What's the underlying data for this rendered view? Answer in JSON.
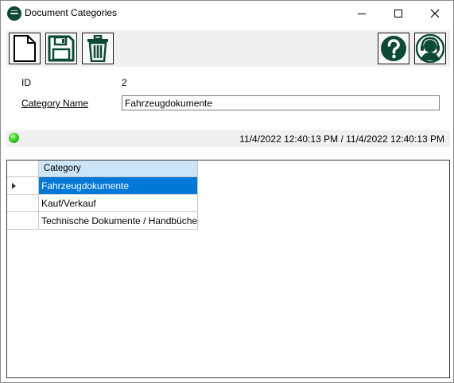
{
  "window": {
    "title": "Document Categories"
  },
  "toolbar": {
    "buttons": [
      {
        "name": "new",
        "icon": "new-document-icon"
      },
      {
        "name": "save",
        "icon": "save-icon"
      },
      {
        "name": "delete",
        "icon": "trash-icon"
      },
      {
        "name": "help",
        "icon": "help-icon"
      },
      {
        "name": "support",
        "icon": "support-headset-icon"
      }
    ],
    "icon_color": "#0d4a33"
  },
  "form": {
    "id_label": "ID",
    "id_value": "2",
    "category_label": "Category Name",
    "category_value": "Fahrzeugdokumente"
  },
  "status": {
    "indicator_color": "#3fcf2a",
    "timestamps": "11/4/2022 12:40:13 PM / 11/4/2022 12:40:13 PM"
  },
  "grid": {
    "columns": [
      "Category"
    ],
    "rows": [
      {
        "category": "Fahrzeugdokumente",
        "selected": true
      },
      {
        "category": "Kauf/Verkauf",
        "selected": false
      },
      {
        "category": "Technische Dokumente / Handbücher",
        "selected": false
      }
    ],
    "selection_color": "#0078d7",
    "header_color": "#cce4f7"
  }
}
